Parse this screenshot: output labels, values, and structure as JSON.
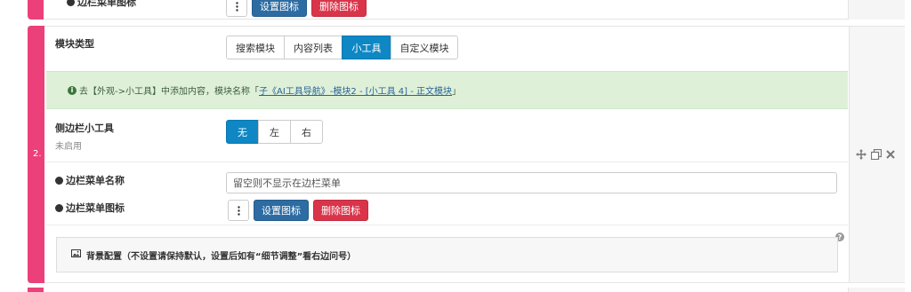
{
  "previous_block": {
    "menu_icon_label": "边栏菜单图标",
    "set_icon": "设置图标",
    "delete_icon": "删除图标"
  },
  "block": {
    "number": "2.",
    "module_type_label": "模块类型",
    "module_types": [
      "搜索模块",
      "内容列表",
      "小工具",
      "自定义模块"
    ],
    "module_type_selected": "小工具",
    "notice_prefix": "去【外观->小工具】中添加内容，模块名称「",
    "notice_link": "子《AI工具导航》-模块2 - [小工具 4] - 正文模块",
    "notice_suffix": "」",
    "sidebar_widget_label": "侧边栏小工具",
    "sidebar_widget_status": "未启用",
    "sidebar_options": [
      "无",
      "左",
      "右"
    ],
    "sidebar_selected": "无",
    "menu_name_label": "边栏菜单名称",
    "menu_name_placeholder": "留空则不显示在边栏菜单",
    "menu_icon_label": "边栏菜单图标",
    "set_icon": "设置图标",
    "delete_icon": "删除图标",
    "bg_config_label": "背景配置（不设置请保持默认，设置后如有“细节调整”看右边问号）"
  },
  "colors": {
    "accent": "#ec407a",
    "primary": "#0e87c4",
    "button_blue": "#2d6ca2",
    "button_red": "#d9344a",
    "notice_bg": "#dff0d8"
  },
  "icons": [
    "plus-circle-icon",
    "info-circle-icon",
    "kebab-icon",
    "move-icon",
    "copy-icon",
    "close-icon",
    "image-icon",
    "question-icon"
  ]
}
